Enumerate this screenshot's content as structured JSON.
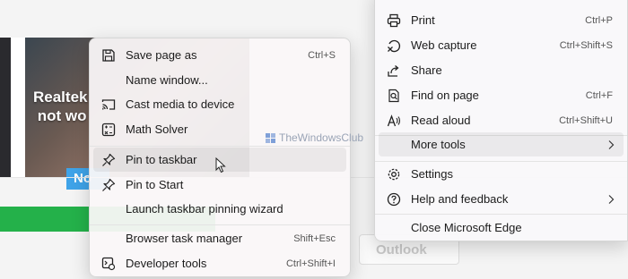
{
  "page": {
    "thumbnail_title": "Realtek\n not wo",
    "thumbnail_badge": "No",
    "outlook_button": "Outlook"
  },
  "watermark": "TheWindowsClub",
  "main_menu": {
    "items": [
      {
        "label": "Print",
        "shortcut": "Ctrl+P",
        "icon": "printer-icon"
      },
      {
        "label": "Web capture",
        "shortcut": "Ctrl+Shift+S",
        "icon": "web-capture-icon"
      },
      {
        "label": "Share",
        "shortcut": "",
        "icon": "share-icon"
      },
      {
        "label": "Find on page",
        "shortcut": "Ctrl+F",
        "icon": "find-icon"
      },
      {
        "label": "Read aloud",
        "shortcut": "Ctrl+Shift+U",
        "icon": "read-aloud-icon"
      },
      {
        "label": "More tools",
        "shortcut": "",
        "icon": ""
      },
      {
        "label": "Settings",
        "shortcut": "",
        "icon": "gear-icon"
      },
      {
        "label": "Help and feedback",
        "shortcut": "",
        "icon": "help-icon"
      },
      {
        "label": "Close Microsoft Edge",
        "shortcut": "",
        "icon": ""
      }
    ]
  },
  "sub_menu": {
    "items": [
      {
        "label": "Save page as",
        "shortcut": "Ctrl+S",
        "icon": "save-icon"
      },
      {
        "label": "Name window...",
        "shortcut": "",
        "icon": ""
      },
      {
        "label": "Cast media to device",
        "shortcut": "",
        "icon": "cast-icon"
      },
      {
        "label": "Math Solver",
        "shortcut": "",
        "icon": "math-solver-icon"
      },
      {
        "label": "Pin to taskbar",
        "shortcut": "",
        "icon": "pin-icon"
      },
      {
        "label": "Pin to Start",
        "shortcut": "",
        "icon": "pin-icon"
      },
      {
        "label": "Launch taskbar pinning wizard",
        "shortcut": "",
        "icon": ""
      },
      {
        "label": "Browser task manager",
        "shortcut": "Shift+Esc",
        "icon": ""
      },
      {
        "label": "Developer tools",
        "shortcut": "Ctrl+Shift+I",
        "icon": "developer-tools-icon"
      }
    ]
  }
}
